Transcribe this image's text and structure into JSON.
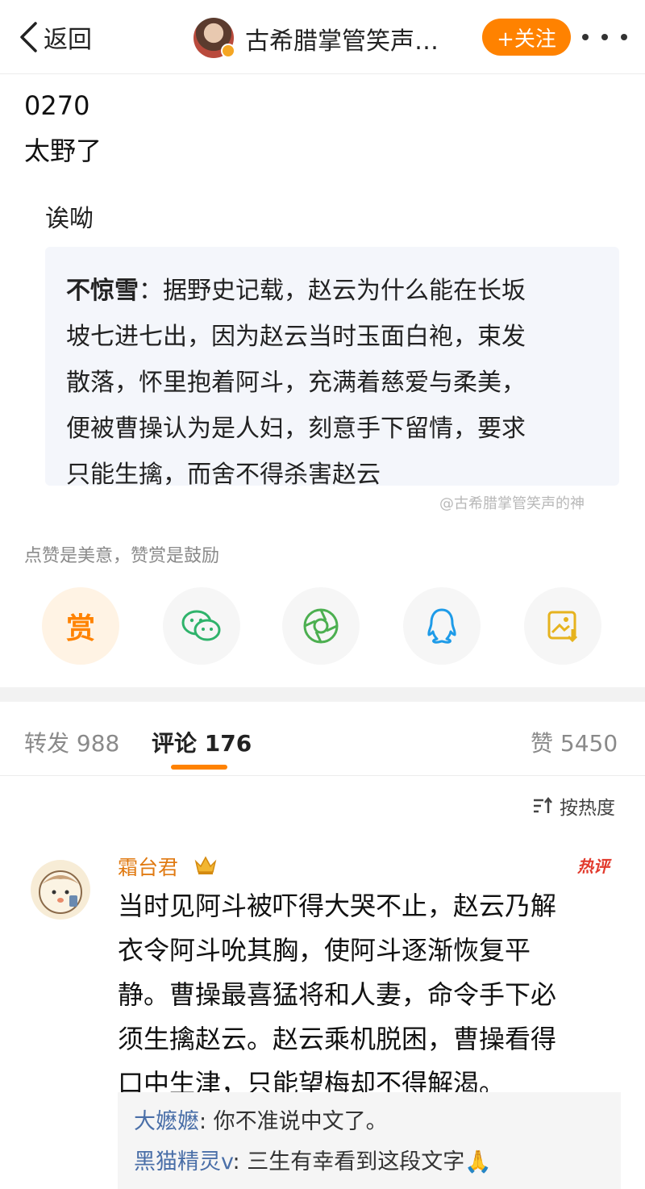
{
  "nav": {
    "back_label": "返回",
    "title": "古希腊掌管笑声…",
    "follow_label": "+关注"
  },
  "post": {
    "line1": "0270",
    "line2": "太野了",
    "sub": "诶呦",
    "quote": {
      "author": "不惊雪",
      "lines": [
        "：据野史记载，赵云为什么能在长坂",
        "坡七进七出，因为赵云当时玉面白袍，束发",
        "散落，怀里抱着阿斗，充满着慈爱与柔美，",
        "便被曹操认为是人妇，刻意手下留情，要求",
        "只能生擒，而舍不得杀害赵云"
      ]
    },
    "watermark": "@古希腊掌管笑声的神",
    "reward_hint": "点赞是美意，赞赏是鼓励"
  },
  "share": {
    "reward_label": "赏",
    "icons": [
      "wechat-icon",
      "moments-icon",
      "qq-icon",
      "save-image-icon"
    ]
  },
  "tabs": {
    "repost": "转发 988",
    "comments": "评论 176",
    "likes": "赞 5450"
  },
  "sort_label": "按热度",
  "comment": {
    "name": "霜台君",
    "tag": "热评",
    "lines": [
      "当时见阿斗被吓得大哭不止，赵云乃解",
      "衣令阿斗吮其胸，使阿斗逐渐恢复平",
      "静。曹操最喜猛将和人妻，命令手下必",
      "须生擒赵云。赵云乘机脱困，曹操看得",
      "口中生津，只能望梅却不得解渴。"
    ],
    "replies": [
      {
        "name": "大嬷嬷",
        "text": ": 你不准说中文了。"
      },
      {
        "name": "黑猫精灵v",
        "text": ": 三生有幸看到这段文字🙏"
      }
    ]
  },
  "colors": {
    "accent": "#ff8200",
    "hot": "#e23a2d",
    "link": "#4a6fa8"
  }
}
